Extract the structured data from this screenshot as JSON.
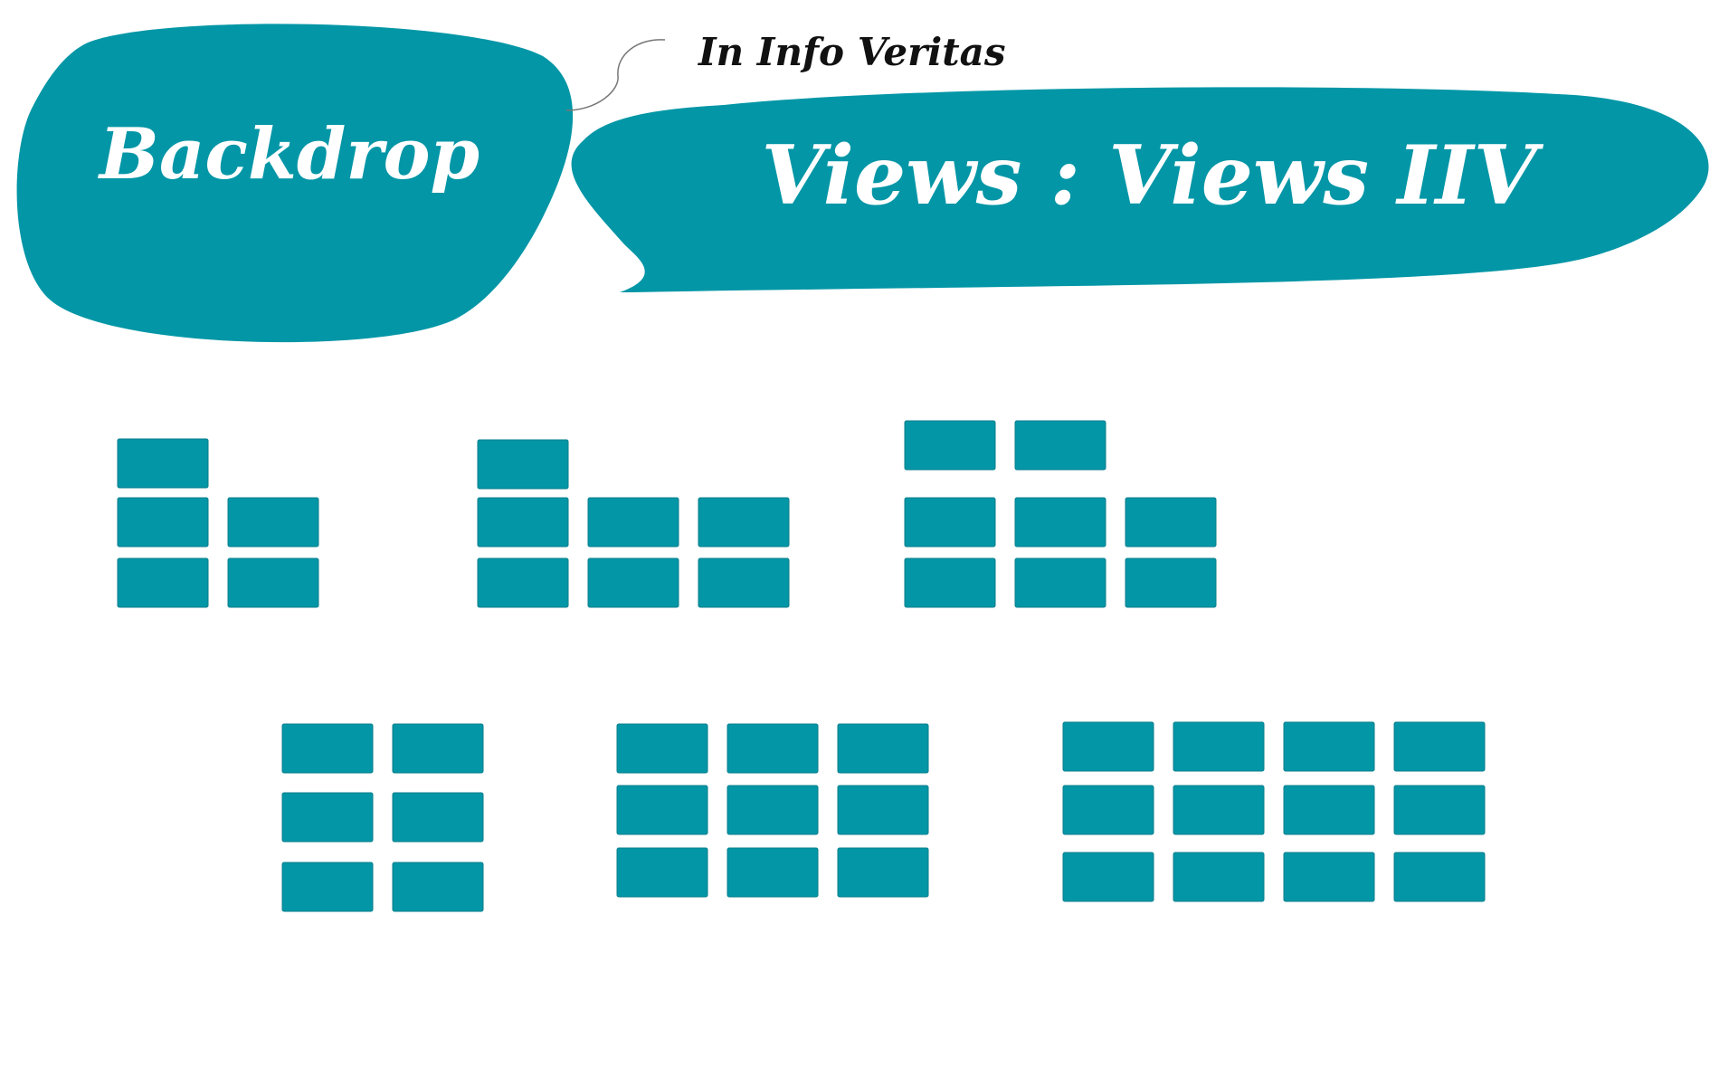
{
  "header": {
    "logo_label": "Backdrop",
    "tagline": "In Info Veritas",
    "banner_label": "Views : Views IIV"
  },
  "colors": {
    "accent": "#0396a6",
    "text_on_accent": "#ffffff",
    "tagline_text": "#111111",
    "connector": "#777777"
  },
  "layouts": [
    {
      "name": "layout-1",
      "rows": [
        1,
        2,
        2
      ]
    },
    {
      "name": "layout-2",
      "rows": [
        1,
        3,
        3
      ]
    },
    {
      "name": "layout-3",
      "rows": [
        2,
        3,
        3
      ]
    },
    {
      "name": "layout-4",
      "rows": [
        2,
        2,
        2
      ]
    },
    {
      "name": "layout-5",
      "rows": [
        3,
        3,
        3
      ]
    },
    {
      "name": "layout-6",
      "rows": [
        4,
        4,
        4
      ]
    }
  ]
}
